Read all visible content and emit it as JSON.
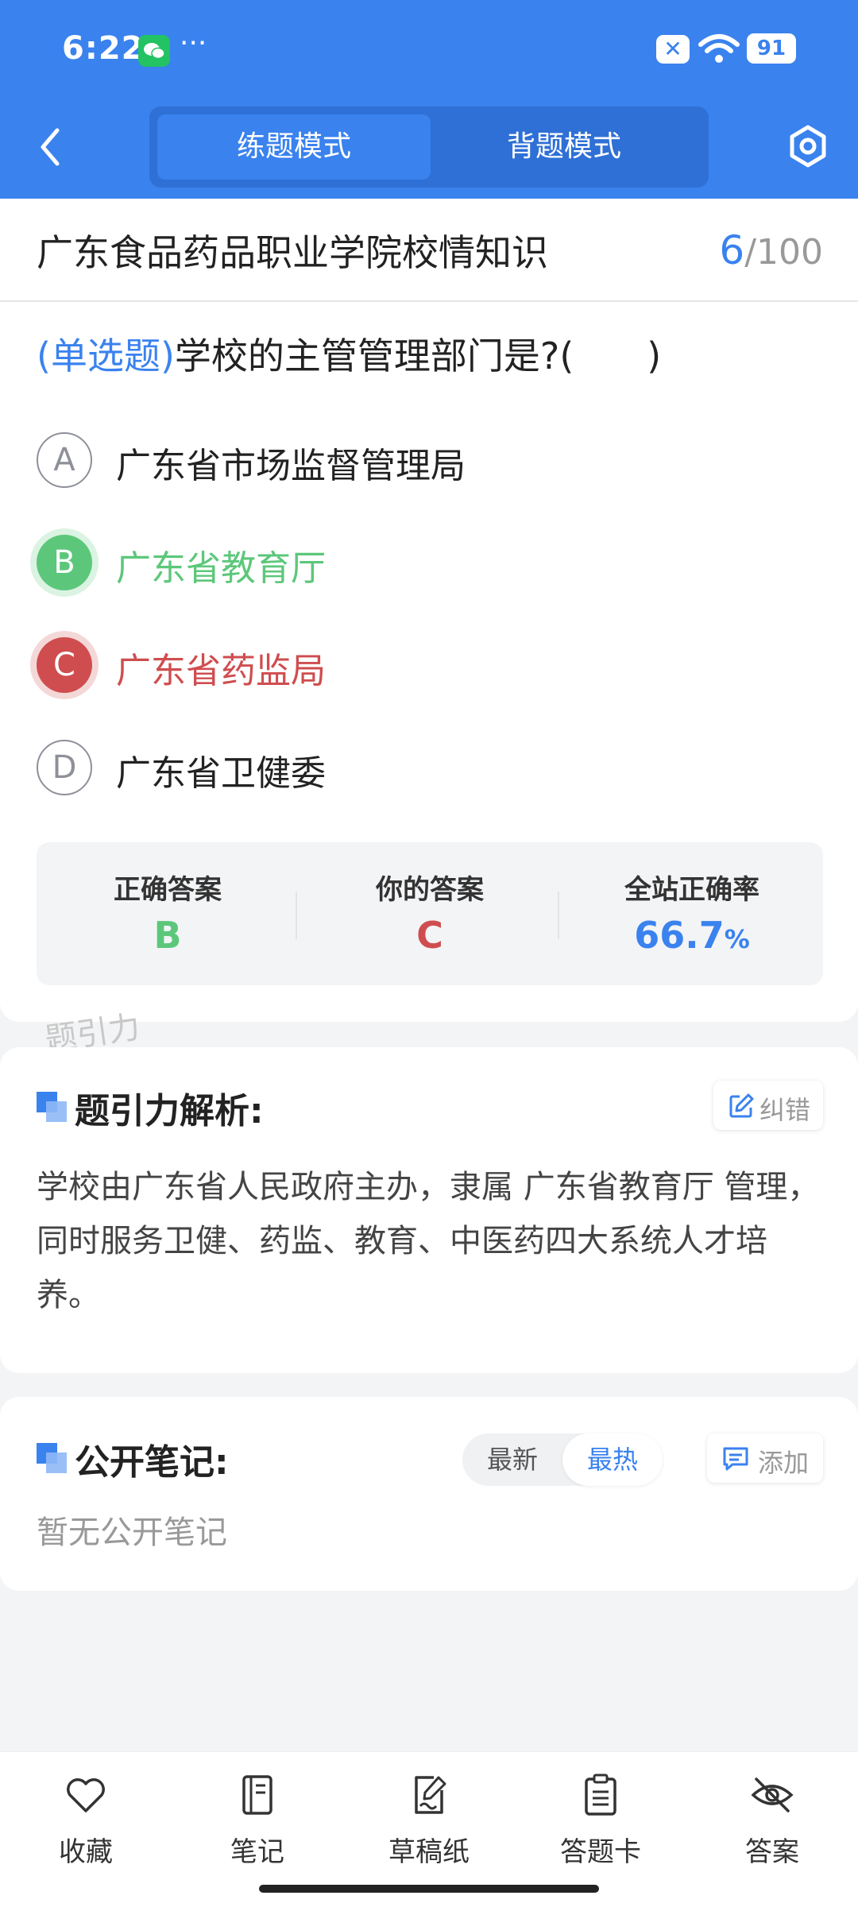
{
  "status_bar": {
    "time": "6:22",
    "more": "···",
    "battery": "91"
  },
  "header": {
    "modes": [
      "练题模式",
      "背题模式"
    ],
    "active_mode": "练题模式"
  },
  "quiz": {
    "title": "广东食品药品职业学院校情知识",
    "current": "6",
    "total": "/100",
    "type_label": "(单选题)",
    "question": "学校的主管管理部门是?(　　)",
    "options": [
      {
        "letter": "A",
        "text": "广东省市场监督管理局",
        "state": "normal"
      },
      {
        "letter": "B",
        "text": "广东省教育厅",
        "state": "correct"
      },
      {
        "letter": "C",
        "text": "广东省药监局",
        "state": "wrong"
      },
      {
        "letter": "D",
        "text": "广东省卫健委",
        "state": "normal"
      }
    ],
    "stats": {
      "correct_label": "正确答案",
      "correct_value": "B",
      "yours_label": "你的答案",
      "yours_value": "C",
      "rate_label": "全站正确率",
      "rate_value": "66.7",
      "rate_unit": "%"
    },
    "watermark": "题引力"
  },
  "analysis": {
    "title": "题引力解析:",
    "report_label": "纠错",
    "text": "学校由广东省人民政府主办，隶属 广东省教育厅 管理，同时服务卫健、药监、教育、中医药四大系统人才培养。"
  },
  "notes": {
    "title": "公开笔记:",
    "sort_latest": "最新",
    "sort_hot": "最热",
    "add_label": "添加",
    "empty_text": "暂无公开笔记"
  },
  "bottom_nav": [
    {
      "label": "收藏",
      "icon": "heart-icon"
    },
    {
      "label": "笔记",
      "icon": "notebook-icon"
    },
    {
      "label": "草稿纸",
      "icon": "draft-pen-icon"
    },
    {
      "label": "答题卡",
      "icon": "clipboard-icon"
    },
    {
      "label": "答案",
      "icon": "eye-off-icon"
    }
  ],
  "colors": {
    "primary": "#3a82ee",
    "correct": "#5cc77a",
    "wrong": "#cf4d4f",
    "background": "#f3f4f6"
  }
}
